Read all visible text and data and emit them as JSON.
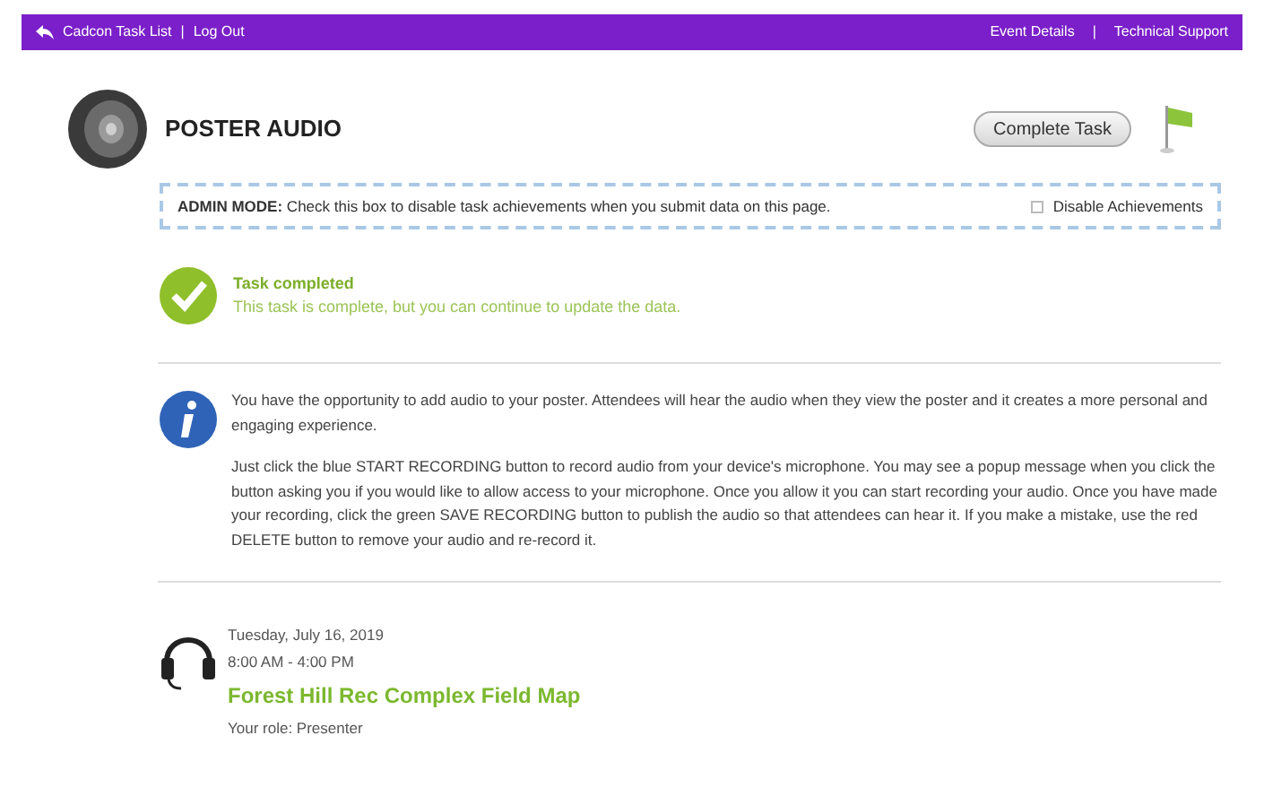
{
  "top_bar": {
    "left_links": [
      "Cadcon Task List",
      "Log Out"
    ],
    "right_links": [
      "Event Details",
      "Technical Support"
    ],
    "separator": "|"
  },
  "header": {
    "title": "POSTER AUDIO",
    "button": "Complete Task"
  },
  "admin": {
    "label": "ADMIN MODE:",
    "text": "Check this box to disable task achievements when you submit data on this page.",
    "checkbox": {
      "label": "Disable Achievements",
      "checked": false
    }
  },
  "status": {
    "title": "Task completed",
    "text": "This task is complete, but you can continue to update the data."
  },
  "info": {
    "paragraphs": [
      "You have the opportunity to add audio to your poster. Attendees will hear the audio when they view the poster and it creates a more personal and engaging experience.",
      "Just click the blue START RECORDING button to record audio from your device's microphone. You may see a popup message when you click the button asking you if you would like to allow access to your microphone. Once you allow it you can start recording your audio. Once you have made your recording, click the green SAVE RECORDING button to publish the audio so that attendees can hear it. If you make a mistake, use the red DELETE button to remove your audio and re-record it."
    ]
  },
  "event": {
    "date": "Tuesday, July 16, 2019",
    "time": "8:00 AM - 4:00 PM",
    "title": "Forest Hill Rec Complex Field Map",
    "role": "Your role: Presenter"
  }
}
